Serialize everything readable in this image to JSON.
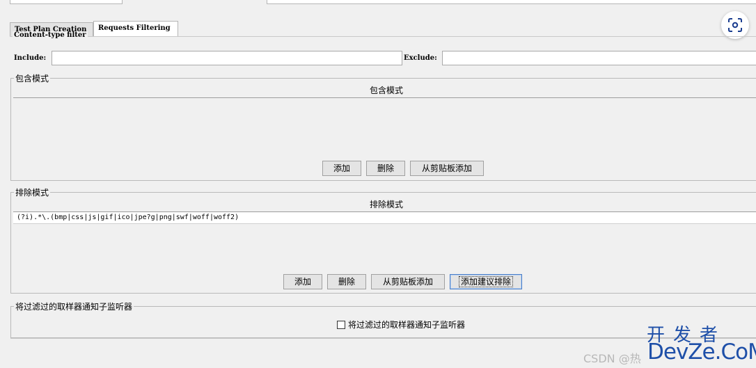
{
  "tabs": [
    {
      "label": "Test Plan Creation"
    },
    {
      "label": "Requests Filtering"
    }
  ],
  "content_filter": {
    "legend": "Content-type filter",
    "include_label": "Include:",
    "include_value": "",
    "exclude_label": "Exclude:",
    "exclude_value": ""
  },
  "include_patterns": {
    "legend": "包含模式",
    "column_header": "包含模式",
    "rows": [],
    "buttons": {
      "add": "添加",
      "delete": "删除",
      "add_from_clipboard": "从剪贴板添加"
    }
  },
  "exclude_patterns": {
    "legend": "排除模式",
    "column_header": "排除模式",
    "rows": [
      "(?i).*\\.(bmp|css|js|gif|ico|jpe?g|png|swf|woff|woff2)"
    ],
    "buttons": {
      "add": "添加",
      "delete": "删除",
      "add_from_clipboard": "从剪贴板添加",
      "add_suggested": "添加建议排除"
    }
  },
  "notify": {
    "legend": "将过滤过的取样器通知子监听器",
    "checkbox_label": "将过滤过的取样器通知子监听器",
    "checked": false
  },
  "watermark": {
    "line1": "开发者",
    "line2": "DevZe.CoM",
    "csdn": "CSDN @热"
  },
  "icons": {
    "lens": "screenshot-lens-icon"
  },
  "colors": {
    "background": "#f0f0f0",
    "watermark": "#1e4fa8",
    "focus_border": "#4a7ec7"
  }
}
